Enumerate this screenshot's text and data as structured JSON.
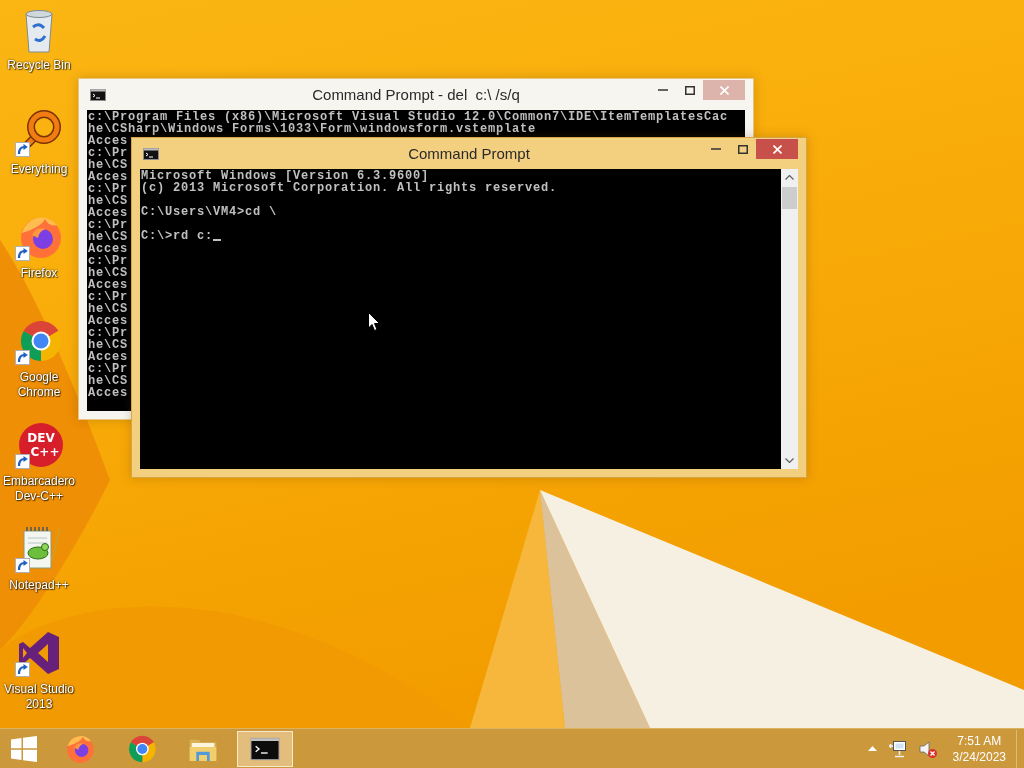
{
  "desktop_icons": [
    {
      "label": "Recycle Bin",
      "kind": "bin",
      "shortcut": false
    },
    {
      "label": "Everything",
      "kind": "search",
      "shortcut": true
    },
    {
      "label": "Firefox",
      "kind": "firefox",
      "shortcut": true
    },
    {
      "label": "Google Chrome",
      "kind": "chrome",
      "shortcut": true
    },
    {
      "label": "Embarcadero Dev-C++",
      "kind": "devcpp",
      "shortcut": true,
      "logo_text": [
        "DEV",
        "C++"
      ]
    },
    {
      "label": "Notepad++",
      "kind": "notepad",
      "shortcut": true
    },
    {
      "label": "Visual Studio 2013",
      "kind": "studio",
      "shortcut": true
    }
  ],
  "windows": [
    {
      "title": "Command Prompt - del  c:\\ /s/q",
      "active": false,
      "blocks": [
        [
          "c:\\Program Files (x86)\\Microsoft Visual Studio 12.0\\Common7\\IDE\\ItemTemplatesCac",
          "he\\CSharp\\Windows Forms\\1033\\Form\\windowsform.vstemplate",
          "Acces",
          "c:\\Pr",
          "he\\CS",
          "Acces",
          "c:\\Pr",
          "he\\CS",
          "Acces",
          "c:\\Pr",
          "he\\CS",
          "Acces",
          "c:\\Pr",
          "he\\CS",
          "Acces",
          "c:\\Pr",
          "he\\CS",
          "Acces",
          "c:\\Pr",
          "he\\CS",
          "Acces",
          "c:\\Pr",
          "he\\CS",
          "Acces"
        ]
      ]
    },
    {
      "title": "Command Prompt",
      "active": true,
      "scrollbar": true,
      "cursor": true,
      "blocks": [
        [
          "Microsoft Windows [Version 6.3.9600]",
          "(c) 2013 Microsoft Corporation. All rights reserved."
        ],
        [
          "C:\\Users\\VM4>cd \\"
        ],
        [
          "C:\\>rd c:"
        ]
      ]
    }
  ],
  "taskbar": {
    "apps": [
      {
        "kind": "firefox",
        "selected": false
      },
      {
        "kind": "chrome",
        "selected": false
      },
      {
        "kind": "folder",
        "selected": false
      },
      {
        "kind": "console",
        "selected": true
      }
    ],
    "tray": {
      "muted": true
    },
    "clock": {
      "time": "7:51 AM",
      "date": "3/24/2023"
    }
  }
}
